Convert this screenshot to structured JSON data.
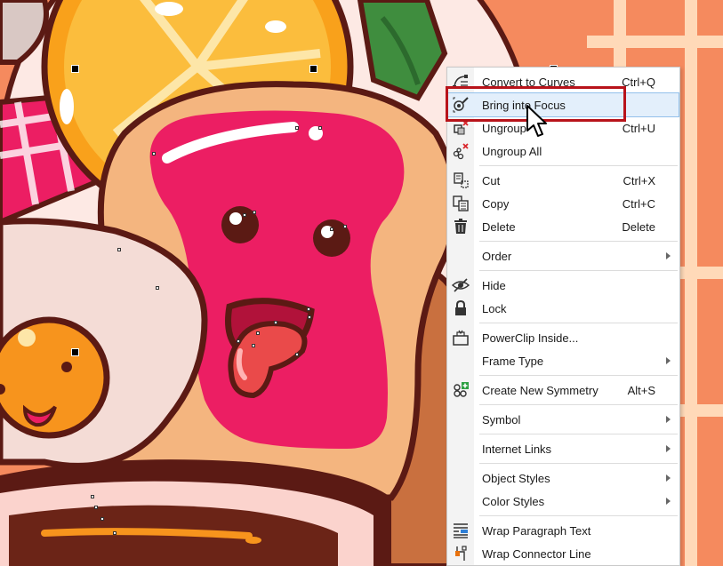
{
  "canvas": {
    "colors": {
      "background_orange": "#f58a5e",
      "stripe_cream": "#ffd9b8",
      "outline_brown": "#5b1a14",
      "jam_pink": "#ec1e63",
      "toast_crust": "#f4b57f",
      "orange_fruit": "#f9a11b",
      "egg_white": "#f4dcd6",
      "egg_yolk": "#f7941d",
      "leaf_green": "#3f8d3e",
      "tongue_red": "#ea4a4a"
    }
  },
  "context_menu": {
    "items": [
      {
        "label": "Convert to Curves",
        "shortcut": "Ctrl+Q",
        "icon": "convert-curves-icon"
      },
      {
        "label": "Bring into Focus",
        "shortcut": "",
        "icon": "bring-into-focus-icon",
        "highlighted": true
      },
      {
        "label": "Ungroup",
        "shortcut": "Ctrl+U",
        "icon": "ungroup-icon"
      },
      {
        "label": "Ungroup All",
        "shortcut": "",
        "icon": "ungroup-all-icon"
      },
      {
        "label": "Cut",
        "shortcut": "Ctrl+X",
        "icon": "cut-icon"
      },
      {
        "label": "Copy",
        "shortcut": "Ctrl+C",
        "icon": "copy-icon"
      },
      {
        "label": "Delete",
        "shortcut": "Delete",
        "icon": "trash-icon"
      },
      {
        "label": "Order",
        "shortcut": "",
        "icon": "",
        "submenu": true
      },
      {
        "label": "Hide",
        "shortcut": "",
        "icon": "eye-hidden-icon"
      },
      {
        "label": "Lock",
        "shortcut": "",
        "icon": "lock-icon"
      },
      {
        "label": "PowerClip Inside...",
        "shortcut": "",
        "icon": "powerclip-icon"
      },
      {
        "label": "Frame Type",
        "shortcut": "",
        "icon": "",
        "submenu": true
      },
      {
        "label": "Create New Symmetry",
        "shortcut": "Alt+S",
        "icon": "symmetry-icon"
      },
      {
        "label": "Symbol",
        "shortcut": "",
        "icon": "",
        "submenu": true
      },
      {
        "label": "Internet Links",
        "shortcut": "",
        "icon": "",
        "submenu": true
      },
      {
        "label": "Object Styles",
        "shortcut": "",
        "icon": "",
        "submenu": true
      },
      {
        "label": "Color Styles",
        "shortcut": "",
        "icon": "",
        "submenu": true
      },
      {
        "label": "Wrap Paragraph Text",
        "shortcut": "",
        "icon": "wrap-text-icon"
      },
      {
        "label": "Wrap Connector Line",
        "shortcut": "",
        "icon": "connector-icon"
      }
    ]
  }
}
